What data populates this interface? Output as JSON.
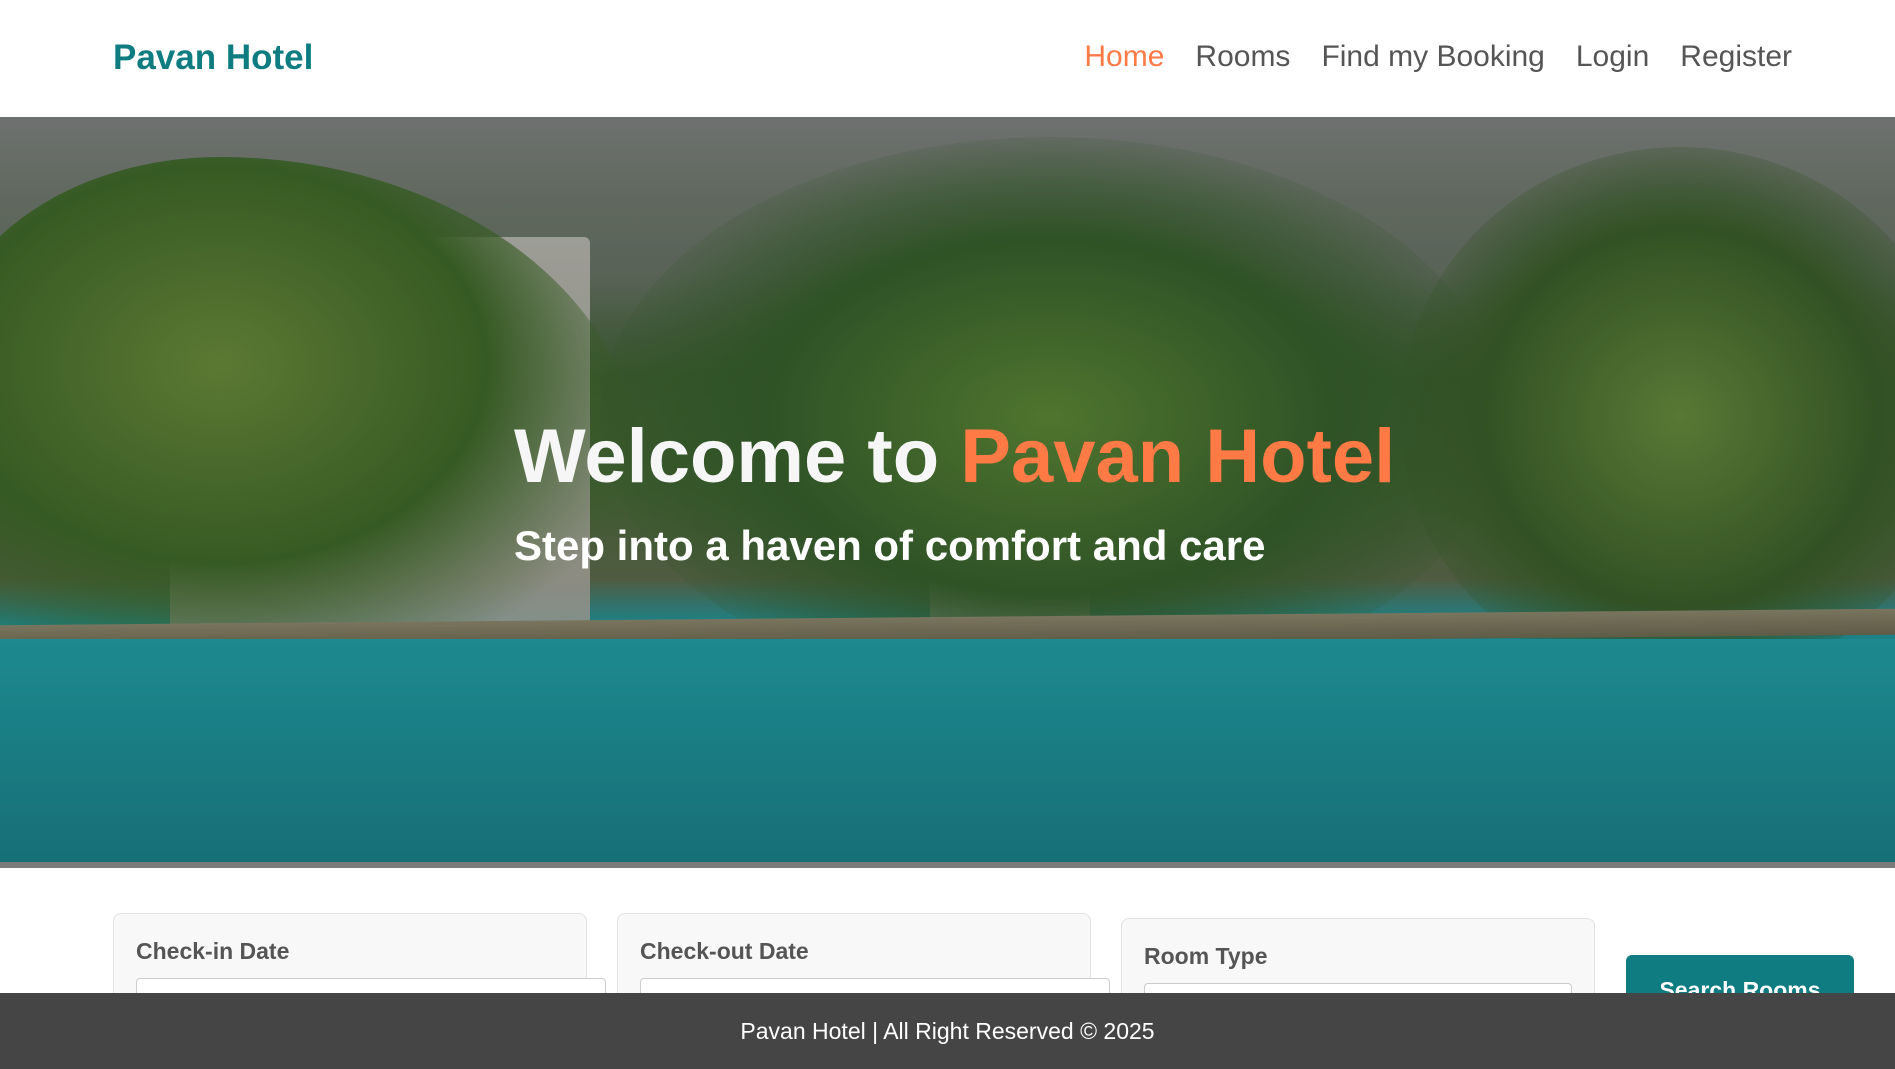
{
  "brand": {
    "name": "Pavan Hotel"
  },
  "nav": {
    "items": [
      {
        "label": "Home",
        "active": true
      },
      {
        "label": "Rooms",
        "active": false
      },
      {
        "label": "Find my Booking",
        "active": false
      },
      {
        "label": "Login",
        "active": false
      },
      {
        "label": "Register",
        "active": false
      }
    ]
  },
  "hero": {
    "title_prefix": "Welcome to ",
    "title_accent": "Pavan Hotel",
    "subtitle": "Step into a haven of comfort and care"
  },
  "search": {
    "checkin_label": "Check-in Date",
    "checkout_label": "Check-out Date",
    "room_type_label": "Room Type",
    "button_label": "Search Rooms"
  },
  "footer": {
    "text": "Pavan Hotel | All Right Reserved © 2025"
  },
  "colors": {
    "brand": "#0e7c80",
    "accent": "#ff7a45",
    "footer_bg": "#454545"
  }
}
